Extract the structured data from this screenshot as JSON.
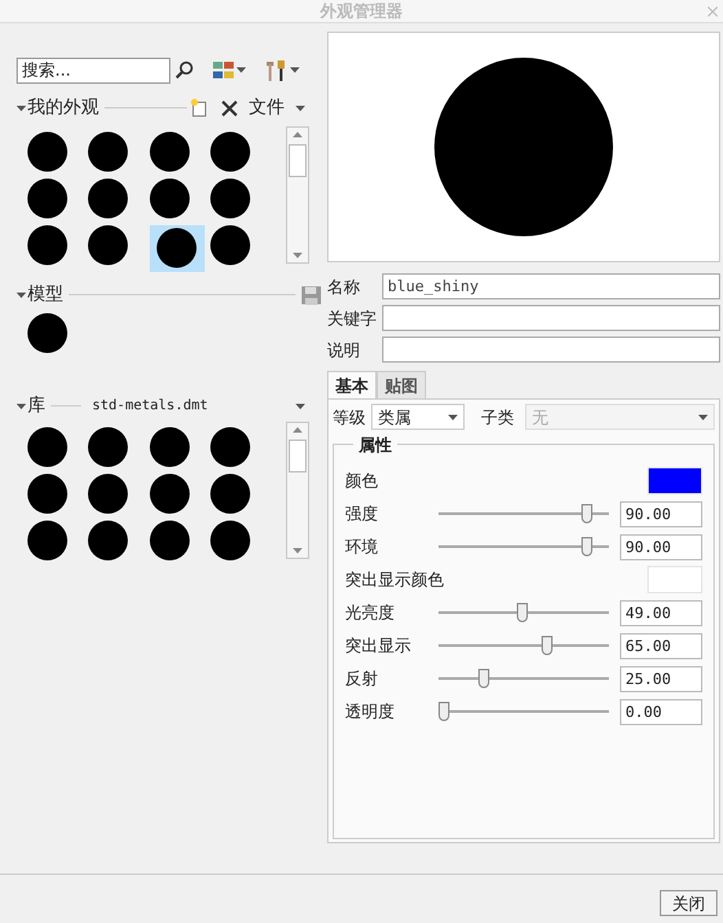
{
  "window": {
    "title": "外观管理器"
  },
  "search": {
    "placeholder": "搜索..."
  },
  "my_appearances": {
    "title": "我的外观",
    "file_menu": "文件",
    "swatches": [
      {
        "selected": false
      },
      {
        "selected": false
      },
      {
        "selected": false
      },
      {
        "selected": false
      },
      {
        "selected": false
      },
      {
        "selected": false
      },
      {
        "selected": false
      },
      {
        "selected": false
      },
      {
        "selected": false
      },
      {
        "selected": false
      },
      {
        "selected": true
      },
      {
        "selected": false
      }
    ]
  },
  "model": {
    "title": "模型",
    "swatches": [
      {
        "selected": false
      }
    ]
  },
  "library": {
    "title": "库",
    "file": "std-metals.dmt",
    "swatches": [
      {
        "selected": false
      },
      {
        "selected": false
      },
      {
        "selected": false
      },
      {
        "selected": false
      },
      {
        "selected": false
      },
      {
        "selected": false
      },
      {
        "selected": false
      },
      {
        "selected": false
      },
      {
        "selected": false
      },
      {
        "selected": false
      },
      {
        "selected": false
      },
      {
        "selected": false
      }
    ]
  },
  "fields": [
    {
      "label": "名称",
      "value": "blue_shiny"
    },
    {
      "label": "关键字"
    },
    {
      "label": "说明"
    }
  ],
  "tabs": [
    {
      "label": "基本",
      "selected": true
    },
    {
      "label": "贴图",
      "selected": false
    }
  ],
  "class": {
    "label": "等级",
    "value": "类属"
  },
  "subclass": {
    "label": "子类",
    "value": "无",
    "disabled": true
  },
  "properties": {
    "title": "属性",
    "rows": [
      {
        "kind": "color",
        "label": "颜色",
        "color": "#0000ff"
      },
      {
        "kind": "slider",
        "label": "强度",
        "level": 0.9,
        "value": "90.00"
      },
      {
        "kind": "slider",
        "label": "环境",
        "level": 0.9,
        "value": "90.00"
      },
      {
        "kind": "color",
        "label": "突出显示颜色",
        "color": "#ffffff"
      },
      {
        "kind": "slider",
        "label": "光亮度",
        "level": 0.49,
        "value": "49.00"
      },
      {
        "kind": "slider",
        "label": "突出显示",
        "level": 0.65,
        "value": "65.00"
      },
      {
        "kind": "slider",
        "label": "反射",
        "level": 0.25,
        "value": "25.00"
      },
      {
        "kind": "slider",
        "label": "透明度",
        "level": 0,
        "value": "0.00"
      }
    ]
  },
  "close_button": "关闭"
}
